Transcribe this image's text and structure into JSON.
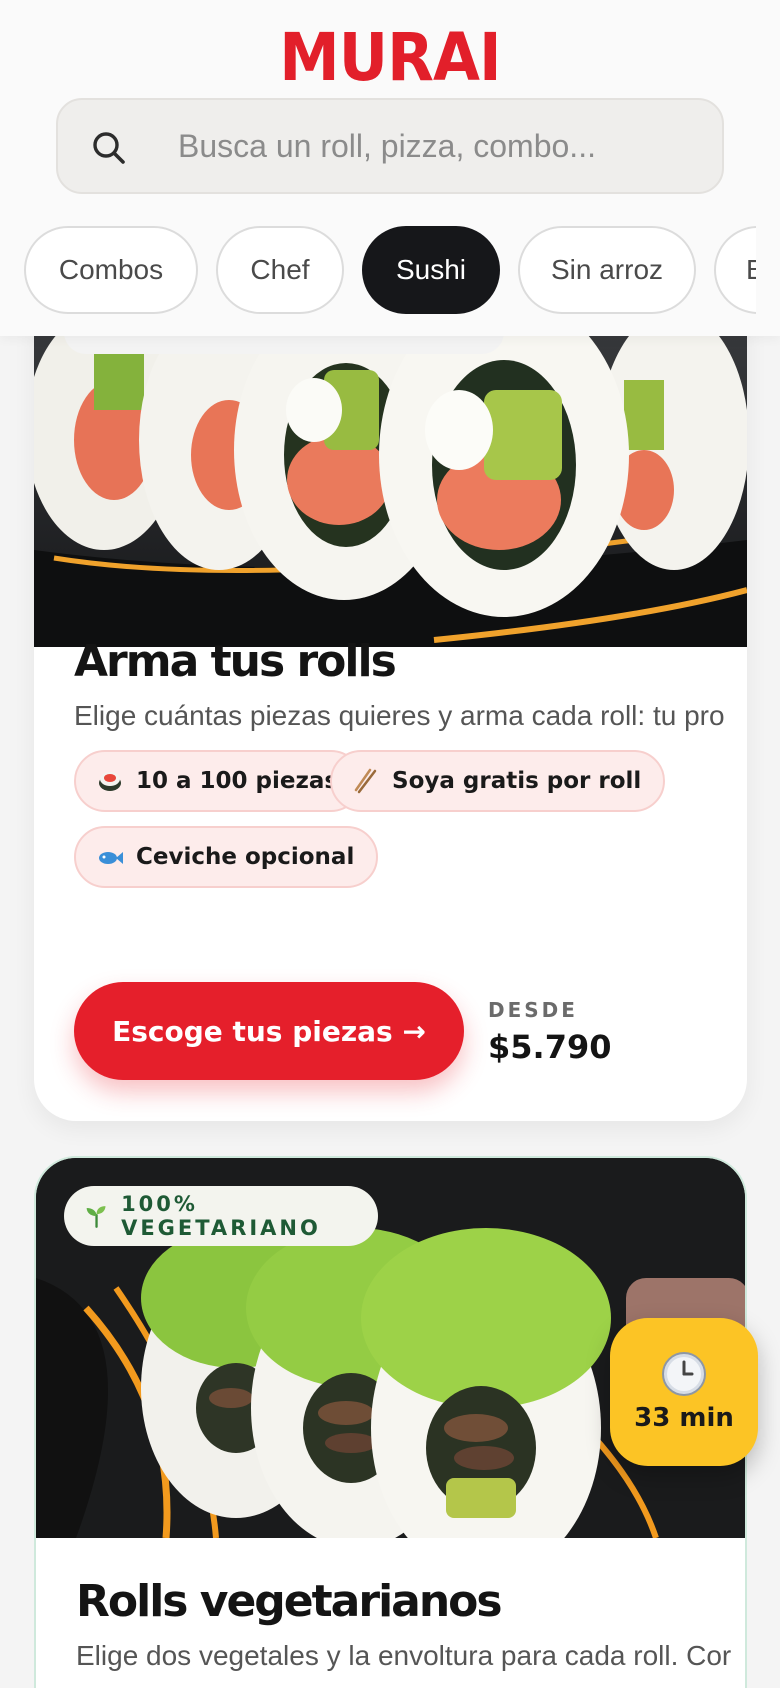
{
  "header": {
    "logo": "MURAI",
    "search": {
      "placeholder": "Busca un roll, pizza, combo...",
      "value": ""
    }
  },
  "categories": [
    {
      "label": "Combos",
      "active": false
    },
    {
      "label": "Chef",
      "active": false
    },
    {
      "label": "Sushi",
      "active": true
    },
    {
      "label": "Sin arroz",
      "active": false
    },
    {
      "label": "B",
      "active": false
    }
  ],
  "cards": [
    {
      "title": "Arma tus rolls",
      "description": "Elige cuántas piezas quieres y arma cada roll: tu pro",
      "features": [
        {
          "icon": "sushi-icon",
          "label": "10 a 100 piezas"
        },
        {
          "icon": "chopsticks-icon",
          "label": "Soya gratis por roll"
        },
        {
          "icon": "fish-icon",
          "label": "Ceviche opcional"
        }
      ],
      "cta_label": "Escoge tus piezas →",
      "price_label": "DESDE",
      "price": "$5.790"
    },
    {
      "badge": "100% VEGETARIANO",
      "title": "Rolls vegetarianos",
      "description": "Elige dos vegetales y la envoltura para cada roll. Cor",
      "time": "33 min"
    }
  ],
  "colors": {
    "brand": "#e21f2a",
    "active_chip": "#16171a",
    "veg_green": "#1e5a35",
    "time_badge": "#fcc425"
  }
}
